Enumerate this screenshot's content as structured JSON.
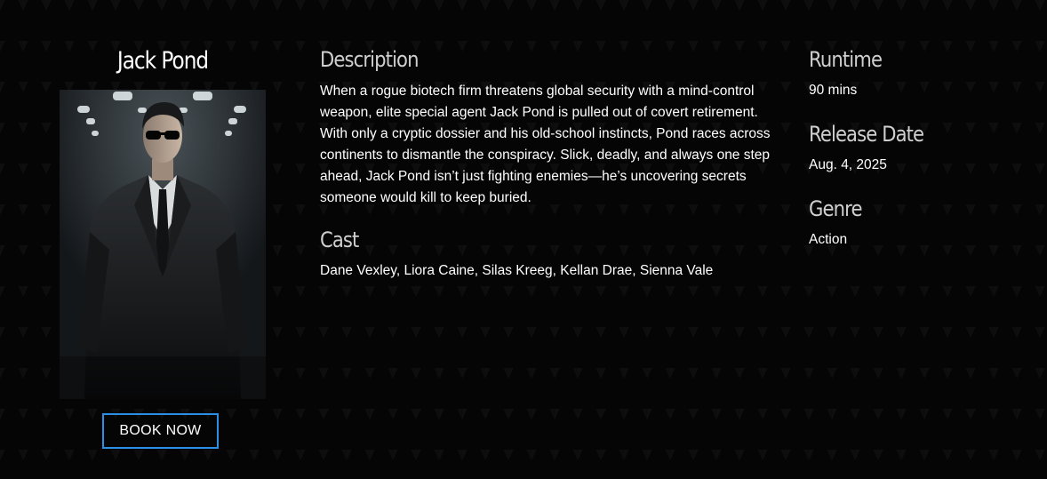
{
  "movie": {
    "title": "Jack Pond",
    "book_button_label": "BOOK NOW"
  },
  "details": {
    "description_heading": "Description",
    "description_text": "When a rogue biotech firm threatens global security with a mind-control weapon, elite special agent Jack Pond is pulled out of covert retirement. With only a cryptic dossier and his old-school instincts, Pond races across continents to dismantle the conspiracy. Slick, deadly, and always one step ahead, Jack Pond isn’t just fighting enemies—he’s uncovering secrets someone would kill to keep buried.",
    "cast_heading": "Cast",
    "cast_text": "Dane Vexley, Liora Caine, Silas Kreeg, Kellan Drae, Sienna Vale"
  },
  "info": {
    "runtime_heading": "Runtime",
    "runtime_value": "90 mins",
    "release_heading": "Release Date",
    "release_value": "Aug. 4, 2025",
    "genre_heading": "Genre",
    "genre_value": "Action"
  },
  "colors": {
    "background": "#050505",
    "button_border": "#2b8fe6",
    "heading_text": "#cfcfcf",
    "body_text": "#ffffff"
  }
}
